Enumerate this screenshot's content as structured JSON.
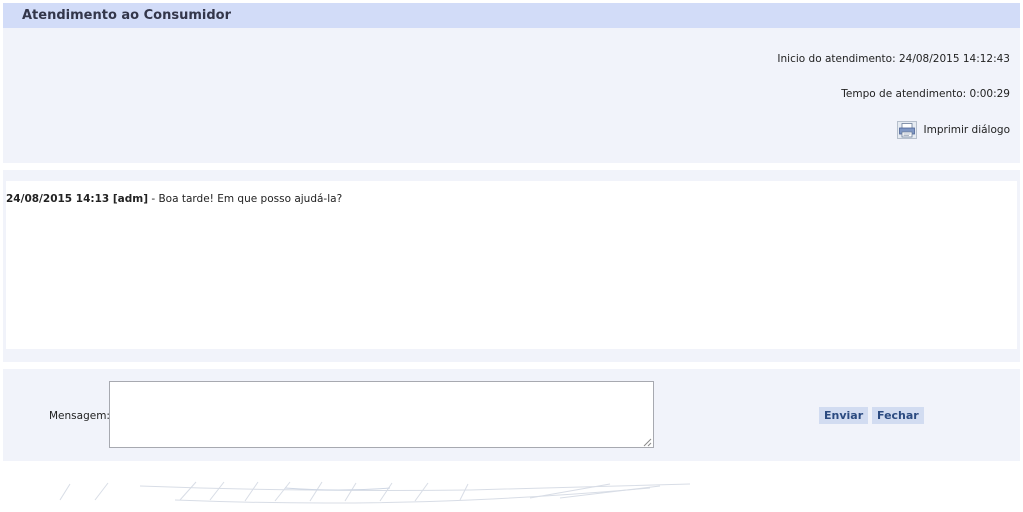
{
  "header": {
    "title": "Atendimento ao Consumidor"
  },
  "info": {
    "start_text": "Inicio do atendimento: 24/08/2015 14:12:43",
    "duration_text": "Tempo de atendimento: 0:00:29",
    "print_label": "Imprimir diálogo",
    "print_icon": "printer-icon"
  },
  "dialog": {
    "messages": [
      {
        "header": "24/08/2015 14:13 [adm]",
        "text": " - Boa tarde! Em que posso ajudá-la?"
      }
    ]
  },
  "compose": {
    "label": "Mensagem:",
    "value": "",
    "send_label": "Enviar",
    "close_label": "Fechar"
  },
  "colors": {
    "header_bg": "#d2dcf8",
    "panel_bg": "#f1f3fa",
    "button_bg": "#d2dcf1",
    "button_text": "#2b4a80"
  }
}
